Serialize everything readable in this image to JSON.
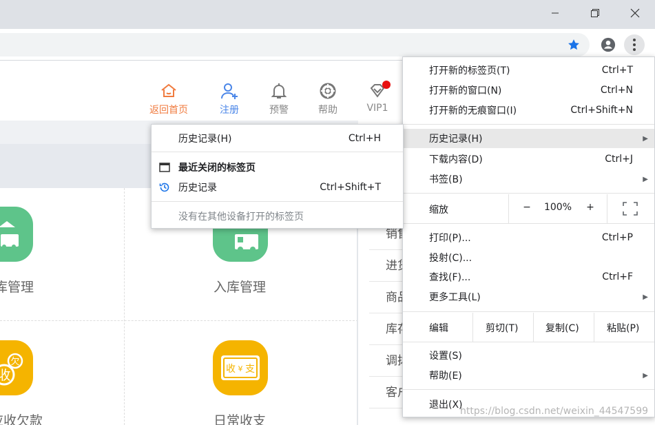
{
  "browser": {
    "window_controls": [
      "minimize",
      "restore",
      "close"
    ],
    "toolbar_icons": [
      "star-icon",
      "account-icon",
      "more-icon"
    ],
    "accent_color": "#1a73e8"
  },
  "page": {
    "nav": [
      {
        "label": "返回首页",
        "icon": "home-icon",
        "color": "#f07b3f"
      },
      {
        "label": "注册",
        "icon": "register-user-icon",
        "color": "#4a86e8"
      },
      {
        "label": "预警",
        "icon": "bell-icon",
        "color": "#888888"
      },
      {
        "label": "帮助",
        "icon": "help-lifebuoy-icon",
        "color": "#888888"
      },
      {
        "label": "VIP1",
        "icon": "vip-diamond-icon",
        "color": "#888888"
      }
    ],
    "tiles": [
      {
        "label": "库管理",
        "color": "#5ec48a"
      },
      {
        "label": "入库管理",
        "color": "#5ec48a"
      },
      {
        "label": "应收欠款",
        "color": "#f5b400"
      },
      {
        "label": "日常收支",
        "color": "#f5b400"
      }
    ],
    "tile_glyphs": {
      "owe": "欠",
      "income": "收",
      "yen": "¥",
      "expense": "支"
    },
    "right_list": [
      "销售",
      "进货",
      "商品",
      "库存",
      "调拨",
      "客户"
    ],
    "watermark": "https://blog.csdn.net/weixin_44547599"
  },
  "menu": {
    "new_tab": {
      "label": "打开新的标签页(T)",
      "shortcut": "Ctrl+T"
    },
    "new_window": {
      "label": "打开新的窗口(N)",
      "shortcut": "Ctrl+N"
    },
    "incognito": {
      "label": "打开新的无痕窗口(I)",
      "shortcut": "Ctrl+Shift+N"
    },
    "history": {
      "label": "历史记录(H)"
    },
    "downloads": {
      "label": "下载内容(D)",
      "shortcut": "Ctrl+J"
    },
    "bookmarks": {
      "label": "书签(B)"
    },
    "zoom": {
      "label": "缩放",
      "minus": "−",
      "value": "100%",
      "plus": "+"
    },
    "print": {
      "label": "打印(P)...",
      "shortcut": "Ctrl+P"
    },
    "cast": {
      "label": "投射(C)..."
    },
    "find": {
      "label": "查找(F)...",
      "shortcut": "Ctrl+F"
    },
    "more_tools": {
      "label": "更多工具(L)"
    },
    "edit": {
      "label": "编辑",
      "cut": "剪切(T)",
      "copy": "复制(C)",
      "paste": "粘贴(P)"
    },
    "settings": {
      "label": "设置(S)"
    },
    "help": {
      "label": "帮助(E)"
    },
    "exit": {
      "label": "退出(X)"
    }
  },
  "history_submenu": {
    "history": {
      "label": "历史记录(H)",
      "shortcut": "Ctrl+H"
    },
    "recently_closed": {
      "label": "最近关闭的标签页"
    },
    "history_entry": {
      "label": "历史记录",
      "shortcut": "Ctrl+Shift+T"
    },
    "no_other_devices": {
      "label": "没有在其他设备打开的标签页"
    }
  }
}
